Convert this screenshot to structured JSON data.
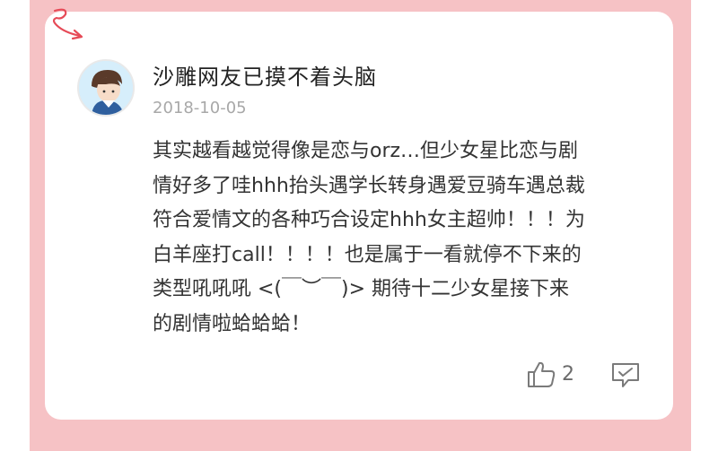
{
  "comment": {
    "username": "沙雕网友已摸不着头脑",
    "date": "2018-10-05",
    "lines": [
      "其实越看越觉得像是恋与orz…但少女星比恋与剧",
      "情好多了哇hhh抬头遇学长转身遇爱豆骑车遇总裁",
      "符合爱情文的各种巧合设定hhh女主超帅！！！为",
      "白羊座打call！！！！也是属于一看就停不下来的",
      "类型吼吼吼  <(￣︶￣)> 期待十二少女星接下来",
      "的剧情啦蛤蛤蛤！"
    ],
    "like_count": "2"
  },
  "icons": {
    "like": "thumbs-up-icon",
    "reply": "comment-bubble-icon",
    "avatar": "avatar"
  },
  "colors": {
    "frame": "#f6c2c5",
    "text": "#333333",
    "meta": "#a8a8a8"
  }
}
